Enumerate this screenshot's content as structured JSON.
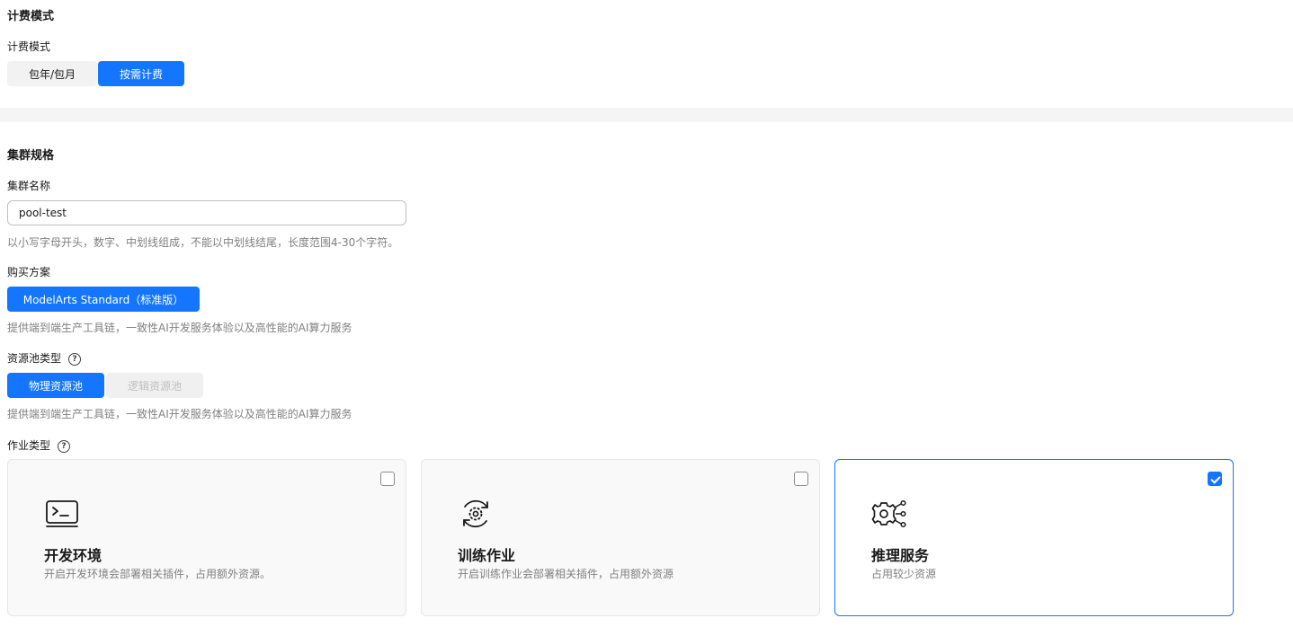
{
  "billing": {
    "section_title": "计费模式",
    "label": "计费模式",
    "options": [
      "包年/包月",
      "按需计费"
    ],
    "selected": "按需计费"
  },
  "cluster": {
    "section_title": "集群规格",
    "name_label": "集群名称",
    "name_value": "pool-test",
    "name_hint": "以小写字母开头，数字、中划线组成，不能以中划线结尾，长度范围4-30个字符。",
    "plan_label": "购买方案",
    "plan_option": "ModelArts Standard（标准版）",
    "plan_hint": "提供端到端生产工具链，一致性AI开发服务体验以及高性能的AI算力服务",
    "pool_type_label": "资源池类型",
    "pool_type_options": [
      "物理资源池",
      "逻辑资源池"
    ],
    "pool_type_selected": "物理资源池",
    "pool_type_hint": "提供端到端生产工具链，一致性AI开发服务体验以及高性能的AI算力服务",
    "job_type_label": "作业类型",
    "job_types": [
      {
        "title": "开发环境",
        "desc": "开启开发环境会部署相关插件，占用额外资源。",
        "icon": "terminal-icon",
        "checked": false
      },
      {
        "title": "训练作业",
        "desc": "开启训练作业会部署相关插件，占用额外资源",
        "icon": "training-gear-icon",
        "checked": false
      },
      {
        "title": "推理服务",
        "desc": "占用较少资源",
        "icon": "inference-gear-icon",
        "checked": true
      }
    ]
  },
  "colors": {
    "primary": "#1476ff",
    "hint": "#808080",
    "band": "#f5f5f5"
  },
  "help_icon_glyph": "?"
}
